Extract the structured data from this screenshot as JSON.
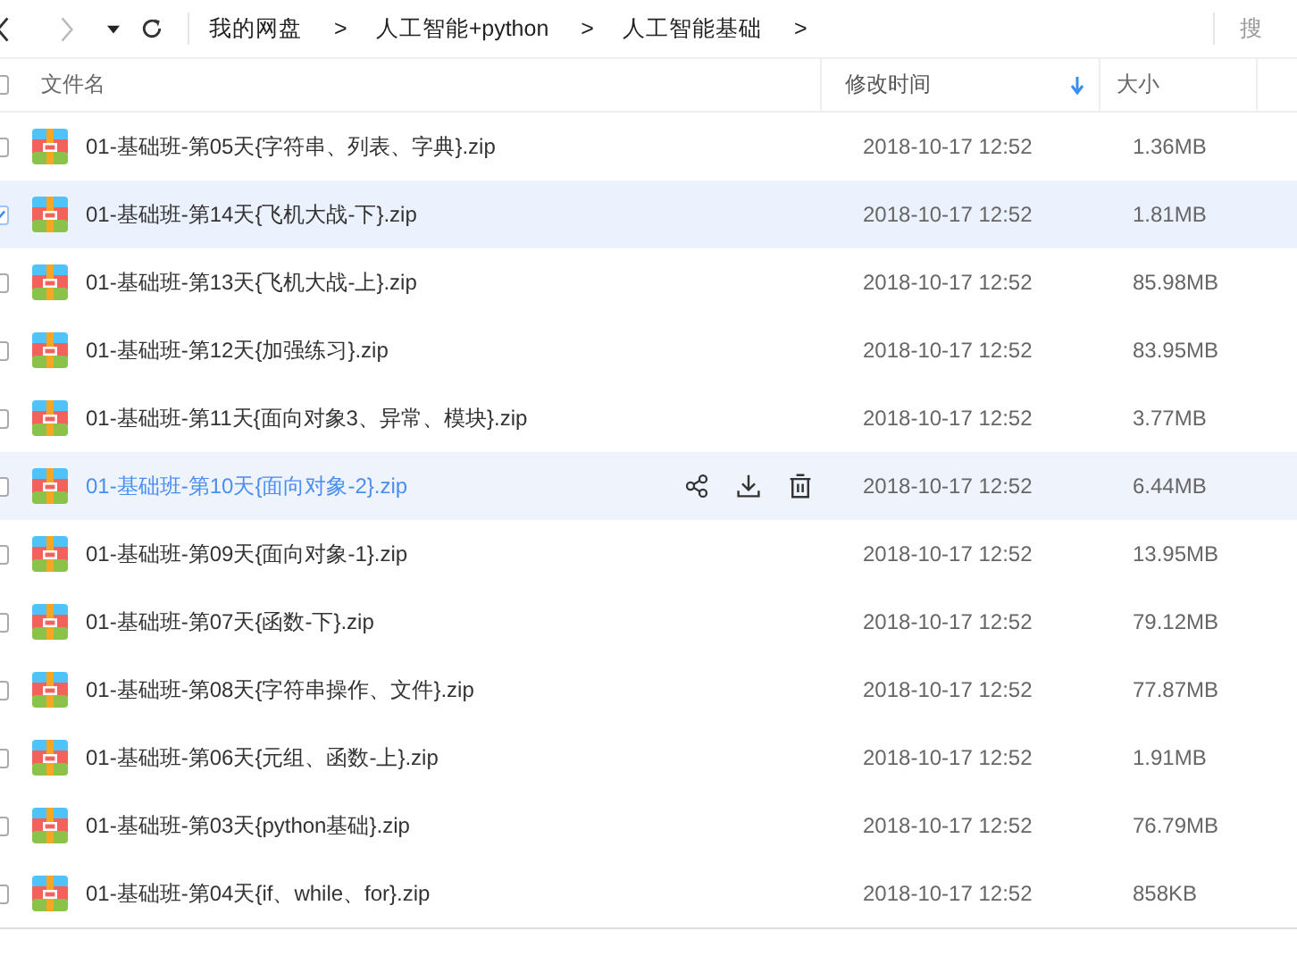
{
  "toolbar": {
    "breadcrumb": [
      "我的网盘",
      "人工智能+python",
      "人工智能基础"
    ],
    "separator": ">",
    "search": {
      "placeholder": "搜"
    }
  },
  "table": {
    "all_checked": false,
    "columns": [
      {
        "label": "文件名",
        "sorted": false
      },
      {
        "label": "修改时间",
        "sorted": true
      },
      {
        "label": "大小",
        "sorted": false
      }
    ],
    "rows": [
      {
        "name": "01-基础班-第05天{字符串、列表、字典}.zip",
        "modified": "2018-10-17 12:52",
        "size": "1.36MB",
        "selected": false,
        "hovered": false
      },
      {
        "name": "01-基础班-第14天{飞机大战-下}.zip",
        "modified": "2018-10-17 12:52",
        "size": "1.81MB",
        "selected": true,
        "hovered": false
      },
      {
        "name": "01-基础班-第13天{飞机大战-上}.zip",
        "modified": "2018-10-17 12:52",
        "size": "85.98MB",
        "selected": false,
        "hovered": false
      },
      {
        "name": "01-基础班-第12天{加强练习}.zip",
        "modified": "2018-10-17 12:52",
        "size": "83.95MB",
        "selected": false,
        "hovered": false
      },
      {
        "name": "01-基础班-第11天{面向对象3、异常、模块}.zip",
        "modified": "2018-10-17 12:52",
        "size": "3.77MB",
        "selected": false,
        "hovered": false
      },
      {
        "name": "01-基础班-第10天{面向对象-2}.zip",
        "modified": "2018-10-17 12:52",
        "size": "6.44MB",
        "selected": false,
        "hovered": true
      },
      {
        "name": "01-基础班-第09天{面向对象-1}.zip",
        "modified": "2018-10-17 12:52",
        "size": "13.95MB",
        "selected": false,
        "hovered": false
      },
      {
        "name": "01-基础班-第07天{函数-下}.zip",
        "modified": "2018-10-17 12:52",
        "size": "79.12MB",
        "selected": false,
        "hovered": false
      },
      {
        "name": "01-基础班-第08天{字符串操作、文件}.zip",
        "modified": "2018-10-17 12:52",
        "size": "77.87MB",
        "selected": false,
        "hovered": false
      },
      {
        "name": "01-基础班-第06天{元组、函数-上}.zip",
        "modified": "2018-10-17 12:52",
        "size": "1.91MB",
        "selected": false,
        "hovered": false
      },
      {
        "name": "01-基础班-第03天{python基础}.zip",
        "modified": "2018-10-17 12:52",
        "size": "76.79MB",
        "selected": false,
        "hovered": false
      },
      {
        "name": "01-基础班-第04天{if、while、for}.zip",
        "modified": "2018-10-17 12:52",
        "size": "858KB",
        "selected": false,
        "hovered": false
      }
    ]
  }
}
